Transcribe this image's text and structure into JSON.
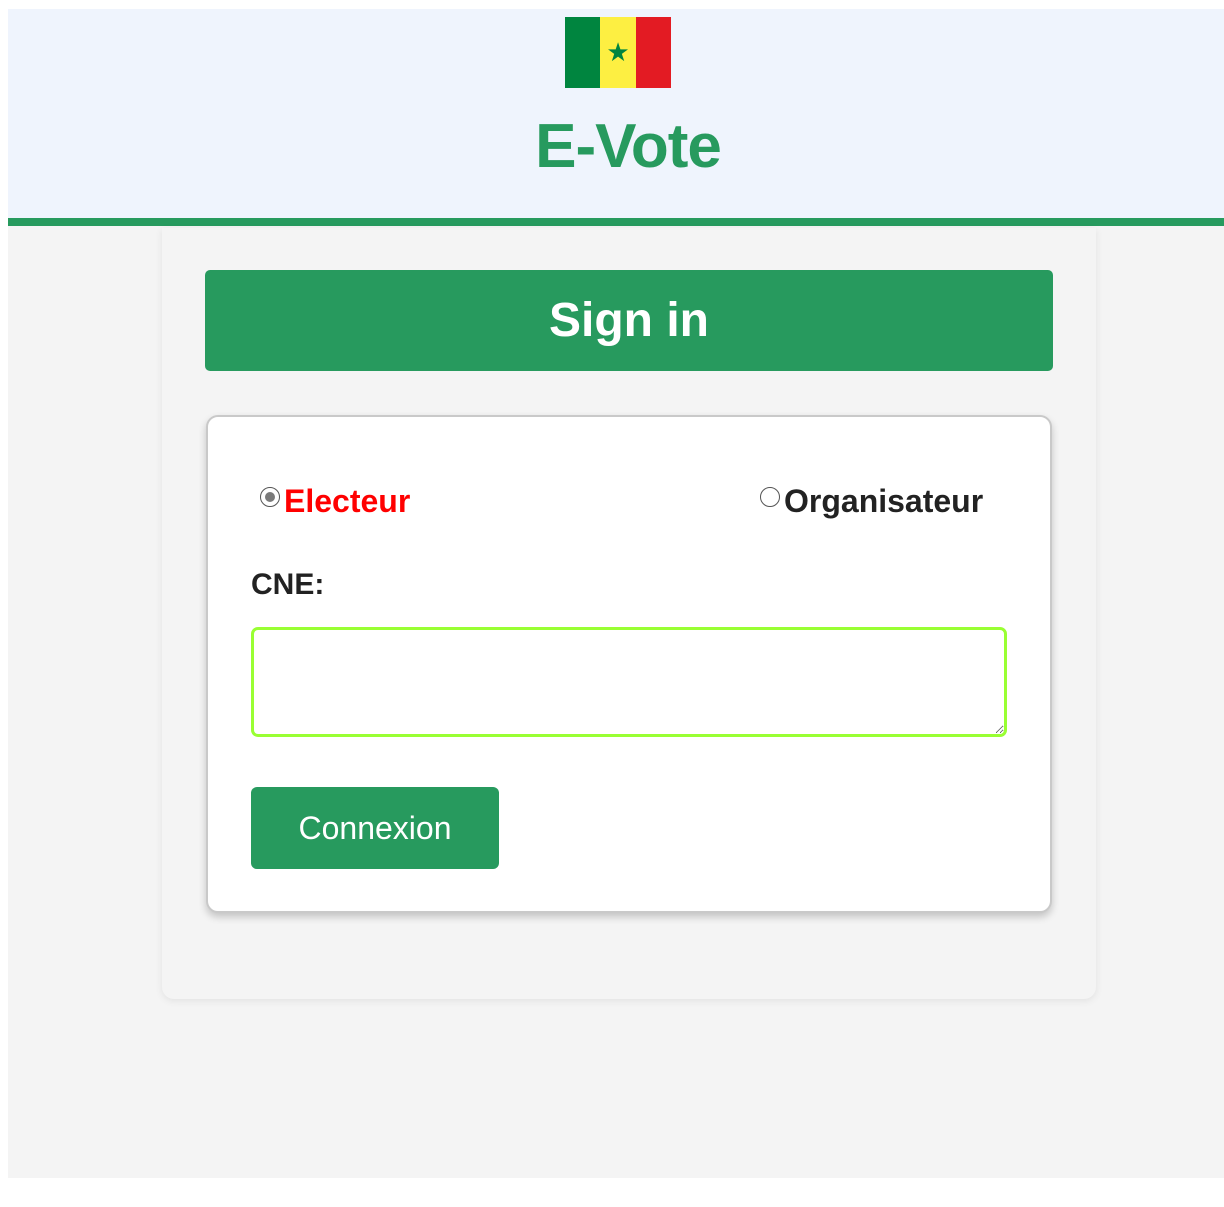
{
  "header": {
    "title": "E-Vote",
    "flag_icon": "senegal-flag-icon",
    "flag_colors": [
      "#00853f",
      "#fdef42",
      "#e31b23"
    ],
    "flag_star": "★",
    "flag_star_color": "#00853f"
  },
  "colors": {
    "brand_green": "#279a5e",
    "title_green": "#279a5e",
    "selected_radio_label": "#ff0000",
    "unselected_radio_label": "#222222",
    "input_border": "#99ff33"
  },
  "signin": {
    "heading": "Sign in"
  },
  "form": {
    "role_options": [
      {
        "label": "Electeur",
        "selected": true
      },
      {
        "label": "Organisateur",
        "selected": false
      }
    ],
    "cne_label": "CNE:",
    "cne_value": "",
    "submit_label": "Connexion"
  }
}
